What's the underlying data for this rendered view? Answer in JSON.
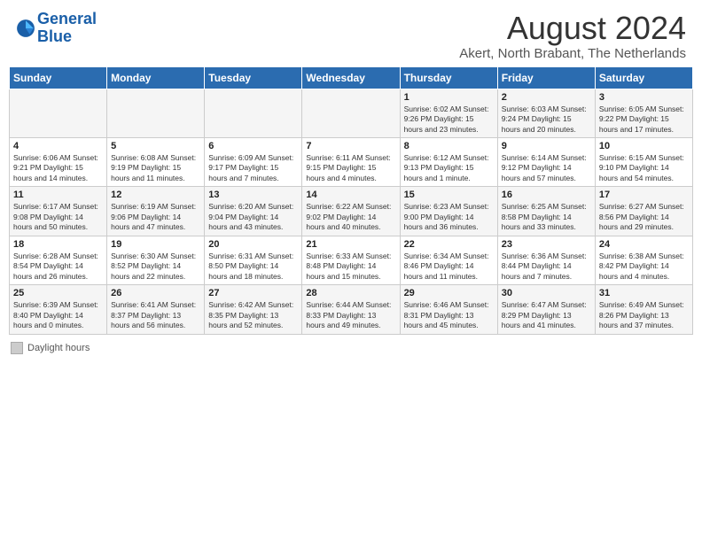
{
  "header": {
    "logo_line1": "General",
    "logo_line2": "Blue",
    "main_title": "August 2024",
    "sub_title": "Akert, North Brabant, The Netherlands"
  },
  "weekdays": [
    "Sunday",
    "Monday",
    "Tuesday",
    "Wednesday",
    "Thursday",
    "Friday",
    "Saturday"
  ],
  "weeks": [
    [
      {
        "day": "",
        "info": ""
      },
      {
        "day": "",
        "info": ""
      },
      {
        "day": "",
        "info": ""
      },
      {
        "day": "",
        "info": ""
      },
      {
        "day": "1",
        "info": "Sunrise: 6:02 AM\nSunset: 9:26 PM\nDaylight: 15 hours\nand 23 minutes."
      },
      {
        "day": "2",
        "info": "Sunrise: 6:03 AM\nSunset: 9:24 PM\nDaylight: 15 hours\nand 20 minutes."
      },
      {
        "day": "3",
        "info": "Sunrise: 6:05 AM\nSunset: 9:22 PM\nDaylight: 15 hours\nand 17 minutes."
      }
    ],
    [
      {
        "day": "4",
        "info": "Sunrise: 6:06 AM\nSunset: 9:21 PM\nDaylight: 15 hours\nand 14 minutes."
      },
      {
        "day": "5",
        "info": "Sunrise: 6:08 AM\nSunset: 9:19 PM\nDaylight: 15 hours\nand 11 minutes."
      },
      {
        "day": "6",
        "info": "Sunrise: 6:09 AM\nSunset: 9:17 PM\nDaylight: 15 hours\nand 7 minutes."
      },
      {
        "day": "7",
        "info": "Sunrise: 6:11 AM\nSunset: 9:15 PM\nDaylight: 15 hours\nand 4 minutes."
      },
      {
        "day": "8",
        "info": "Sunrise: 6:12 AM\nSunset: 9:13 PM\nDaylight: 15 hours\nand 1 minute."
      },
      {
        "day": "9",
        "info": "Sunrise: 6:14 AM\nSunset: 9:12 PM\nDaylight: 14 hours\nand 57 minutes."
      },
      {
        "day": "10",
        "info": "Sunrise: 6:15 AM\nSunset: 9:10 PM\nDaylight: 14 hours\nand 54 minutes."
      }
    ],
    [
      {
        "day": "11",
        "info": "Sunrise: 6:17 AM\nSunset: 9:08 PM\nDaylight: 14 hours\nand 50 minutes."
      },
      {
        "day": "12",
        "info": "Sunrise: 6:19 AM\nSunset: 9:06 PM\nDaylight: 14 hours\nand 47 minutes."
      },
      {
        "day": "13",
        "info": "Sunrise: 6:20 AM\nSunset: 9:04 PM\nDaylight: 14 hours\nand 43 minutes."
      },
      {
        "day": "14",
        "info": "Sunrise: 6:22 AM\nSunset: 9:02 PM\nDaylight: 14 hours\nand 40 minutes."
      },
      {
        "day": "15",
        "info": "Sunrise: 6:23 AM\nSunset: 9:00 PM\nDaylight: 14 hours\nand 36 minutes."
      },
      {
        "day": "16",
        "info": "Sunrise: 6:25 AM\nSunset: 8:58 PM\nDaylight: 14 hours\nand 33 minutes."
      },
      {
        "day": "17",
        "info": "Sunrise: 6:27 AM\nSunset: 8:56 PM\nDaylight: 14 hours\nand 29 minutes."
      }
    ],
    [
      {
        "day": "18",
        "info": "Sunrise: 6:28 AM\nSunset: 8:54 PM\nDaylight: 14 hours\nand 26 minutes."
      },
      {
        "day": "19",
        "info": "Sunrise: 6:30 AM\nSunset: 8:52 PM\nDaylight: 14 hours\nand 22 minutes."
      },
      {
        "day": "20",
        "info": "Sunrise: 6:31 AM\nSunset: 8:50 PM\nDaylight: 14 hours\nand 18 minutes."
      },
      {
        "day": "21",
        "info": "Sunrise: 6:33 AM\nSunset: 8:48 PM\nDaylight: 14 hours\nand 15 minutes."
      },
      {
        "day": "22",
        "info": "Sunrise: 6:34 AM\nSunset: 8:46 PM\nDaylight: 14 hours\nand 11 minutes."
      },
      {
        "day": "23",
        "info": "Sunrise: 6:36 AM\nSunset: 8:44 PM\nDaylight: 14 hours\nand 7 minutes."
      },
      {
        "day": "24",
        "info": "Sunrise: 6:38 AM\nSunset: 8:42 PM\nDaylight: 14 hours\nand 4 minutes."
      }
    ],
    [
      {
        "day": "25",
        "info": "Sunrise: 6:39 AM\nSunset: 8:40 PM\nDaylight: 14 hours\nand 0 minutes."
      },
      {
        "day": "26",
        "info": "Sunrise: 6:41 AM\nSunset: 8:37 PM\nDaylight: 13 hours\nand 56 minutes."
      },
      {
        "day": "27",
        "info": "Sunrise: 6:42 AM\nSunset: 8:35 PM\nDaylight: 13 hours\nand 52 minutes."
      },
      {
        "day": "28",
        "info": "Sunrise: 6:44 AM\nSunset: 8:33 PM\nDaylight: 13 hours\nand 49 minutes."
      },
      {
        "day": "29",
        "info": "Sunrise: 6:46 AM\nSunset: 8:31 PM\nDaylight: 13 hours\nand 45 minutes."
      },
      {
        "day": "30",
        "info": "Sunrise: 6:47 AM\nSunset: 8:29 PM\nDaylight: 13 hours\nand 41 minutes."
      },
      {
        "day": "31",
        "info": "Sunrise: 6:49 AM\nSunset: 8:26 PM\nDaylight: 13 hours\nand 37 minutes."
      }
    ]
  ],
  "legend": {
    "label": "Daylight hours"
  }
}
